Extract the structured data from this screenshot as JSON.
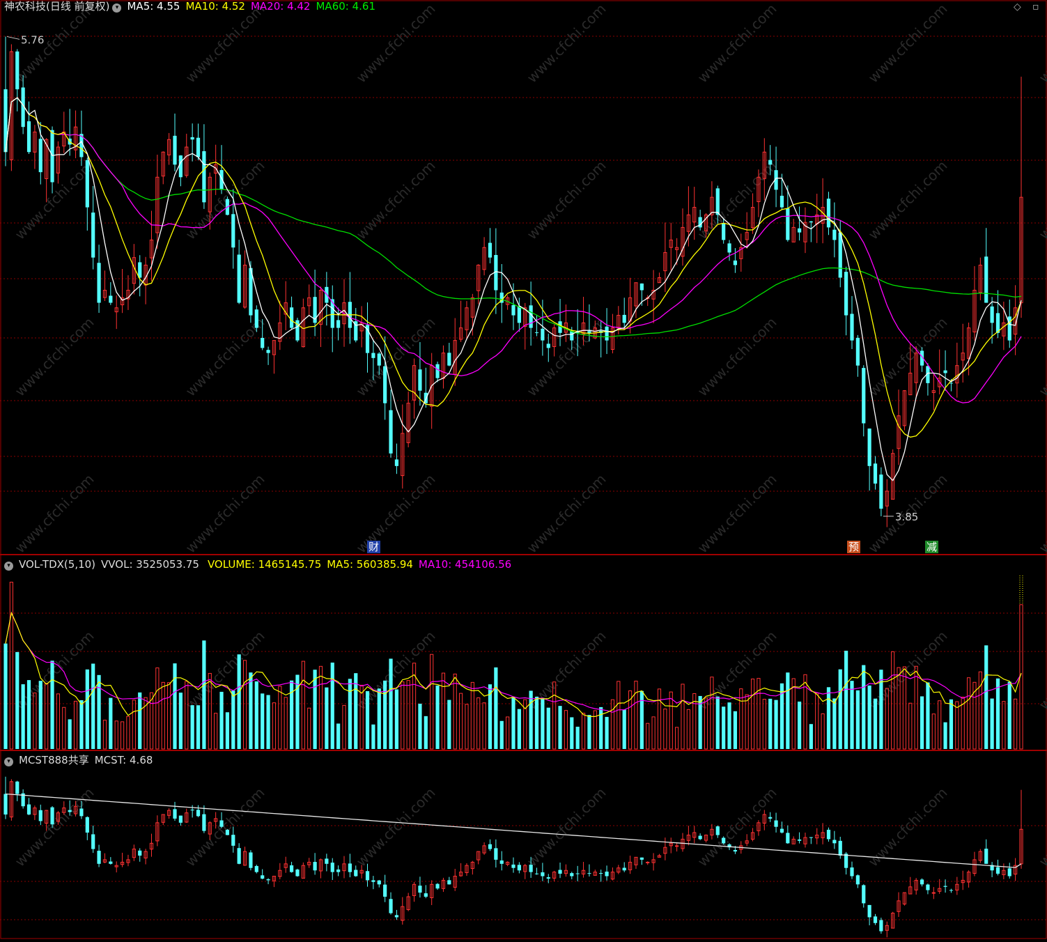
{
  "colors": {
    "up": "#ff3232",
    "down": "#54ffff",
    "ma5": "#ffffff",
    "ma10": "#ffff00",
    "ma20": "#ff00ff",
    "ma60": "#00e000",
    "grid": "#8b0000",
    "frame": "#a00000"
  },
  "main_header": {
    "title": "神农科技(日线 前复权)",
    "ma5": "MA5: 4.55",
    "ma10": "MA10: 4.52",
    "ma20": "MA20: 4.42",
    "ma60": "MA60: 4.61"
  },
  "markers": {
    "high_label": "5.76",
    "low_label": "3.85",
    "tag_cai": "财",
    "tag_yu": "预",
    "tag_jian": "减"
  },
  "vol_header": {
    "name": "VOL-TDX(5,10)",
    "vvol": "VVOL: 3525053.75",
    "volume": "VOLUME: 1465145.75",
    "ma5": "MA5: 560385.94",
    "ma10": "MA10: 454106.56"
  },
  "mcst_header": {
    "name": "MCST888共享",
    "mcst": "MCST: 4.68"
  },
  "watermark": "www.cfchi.com",
  "chart_data": [
    {
      "type": "candlestick",
      "title": "神农科技(日线 前复权)",
      "ylim": [
        3.7,
        5.85
      ],
      "high": 5.76,
      "low": 3.85,
      "closes": [
        5.3,
        5.7,
        5.55,
        5.4,
        5.3,
        5.38,
        5.22,
        5.35,
        5.18,
        5.32,
        5.38,
        5.33,
        5.4,
        5.28,
        5.08,
        4.88,
        4.7,
        4.75,
        4.7,
        4.68,
        4.72,
        4.75,
        4.88,
        4.8,
        4.85,
        4.95,
        5.2,
        5.3,
        5.35,
        5.25,
        5.2,
        5.32,
        5.35,
        5.28,
        5.1,
        5.2,
        5.25,
        5.15,
        5.05,
        4.92,
        4.7,
        4.85,
        4.65,
        4.6,
        4.52,
        4.5,
        4.55,
        4.62,
        4.7,
        4.6,
        4.55,
        4.68,
        4.72,
        4.62,
        4.75,
        4.7,
        4.6,
        4.6,
        4.7,
        4.6,
        4.55,
        4.62,
        4.5,
        4.48,
        4.45,
        4.3,
        4.1,
        4.05,
        4.18,
        4.3,
        4.45,
        4.35,
        4.3,
        4.45,
        4.4,
        4.5,
        4.45,
        4.55,
        4.6,
        4.68,
        4.72,
        4.85,
        4.92,
        4.88,
        4.75,
        4.7,
        4.72,
        4.65,
        4.62,
        4.68,
        4.6,
        4.58,
        4.55,
        4.52,
        4.6,
        4.58,
        4.62,
        4.55,
        4.58,
        4.62,
        4.58,
        4.6,
        4.58,
        4.55,
        4.6,
        4.65,
        4.62,
        4.72,
        4.78,
        4.75,
        4.72,
        4.75,
        4.8,
        4.9,
        4.95,
        4.92,
        5.0,
        5.05,
        5.08,
        5.0,
        5.05,
        5.12,
        5.05,
        4.95,
        4.9,
        4.85,
        4.92,
        4.98,
        5.08,
        5.2,
        5.3,
        5.25,
        5.15,
        5.08,
        4.95,
        5.0,
        4.98,
        5.02,
        5.02,
        5.05,
        5.08,
        5.0,
        4.95,
        4.8,
        4.65,
        4.55,
        4.45,
        4.22,
        4.05,
        3.98,
        3.88,
        3.95,
        4.1,
        4.25,
        4.35,
        4.42,
        4.5,
        4.45,
        4.38,
        4.35,
        4.4,
        4.42,
        4.38,
        4.45,
        4.5,
        4.6,
        4.75,
        4.85,
        4.7,
        4.62,
        4.58,
        4.62,
        4.55,
        4.68,
        5.12
      ],
      "ma_values": {
        "ma5": 4.55,
        "ma10": 4.52,
        "ma20": 4.42,
        "ma60": 4.61
      }
    },
    {
      "type": "bar",
      "title": "VOL-TDX(5,10)",
      "series_latest": {
        "VVOL": 3525053.75,
        "VOLUME": 1465145.75,
        "MA5": 560385.94,
        "MA10": 454106.56
      }
    },
    {
      "type": "line",
      "title": "MCST888共享",
      "series_latest": {
        "MCST": 4.68
      }
    }
  ]
}
